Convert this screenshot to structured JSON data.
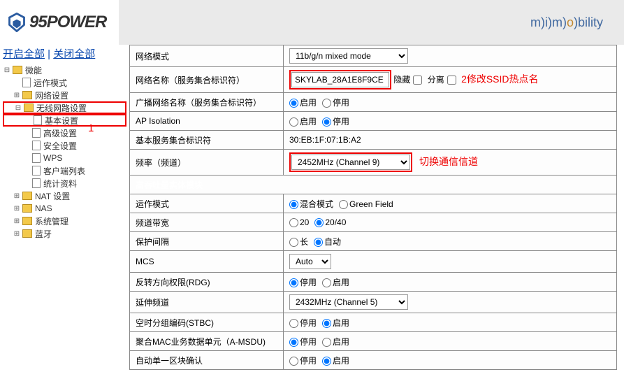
{
  "header": {
    "logo_text": "95POWER",
    "mobility": "bility"
  },
  "toplinks": {
    "open_all": "开启全部",
    "close_all": "关闭全部",
    "sep": " | "
  },
  "tree": {
    "weineng": "微能",
    "run_mode": "运作模式",
    "net_set": "网络设置",
    "wireless_set": "无线网路设置",
    "basic": "基本设置",
    "adv": "高级设置",
    "sec": "安全设置",
    "wps": "WPS",
    "clients": "客户端列表",
    "stats": "统计资料",
    "nat": "NAT 设置",
    "nas": "NAS",
    "sys": "系统管理",
    "bt": "蓝牙"
  },
  "anno": {
    "one": "1",
    "two": "2修改SSID热点名",
    "three": "切换通信信道"
  },
  "form": {
    "net_mode": {
      "label": "网络模式",
      "value": "11b/g/n mixed mode"
    },
    "ssid": {
      "label": "网络名称（服务集合标识符）",
      "value": "SKYLAB_28A1E8F9CE",
      "hide": "隐藏",
      "sep": "分离"
    },
    "bcast": {
      "label": "广播网络名称（服务集合标识符）",
      "on": "启用",
      "off": "停用"
    },
    "ap_iso": {
      "label": "AP Isolation",
      "on": "启用",
      "off": "停用"
    },
    "bssid": {
      "label": "基本服务集合标识符",
      "value": "30:EB:1F:07:1B:A2"
    },
    "freq": {
      "label": "频率（频道）",
      "value": "2452MHz (Channel 9)"
    },
    "ht": "高吞吐量实体模块",
    "opmode": {
      "label": "运作模式",
      "mixed": "混合模式",
      "gf": "Green Field"
    },
    "bw": {
      "label": "频道带宽",
      "v20": "20",
      "v2040": "20/40"
    },
    "gi": {
      "label": "保护间隔",
      "long": "长",
      "auto": "自动"
    },
    "mcs": {
      "label": "MCS",
      "value": "Auto"
    },
    "rdg": {
      "label": "反转方向权限(RDG)",
      "off": "停用",
      "on": "启用"
    },
    "ext": {
      "label": "延伸频道",
      "value": "2432MHz (Channel 5)"
    },
    "stbc": {
      "label": "空时分组编码(STBC)",
      "off": "停用",
      "on": "启用"
    },
    "amsdu": {
      "label": "聚合MAC业务数据单元（A-MSDU)",
      "off": "停用",
      "on": "启用"
    },
    "ba": {
      "label": "自动单一区块确认",
      "off": "停用",
      "on": "启用"
    }
  }
}
